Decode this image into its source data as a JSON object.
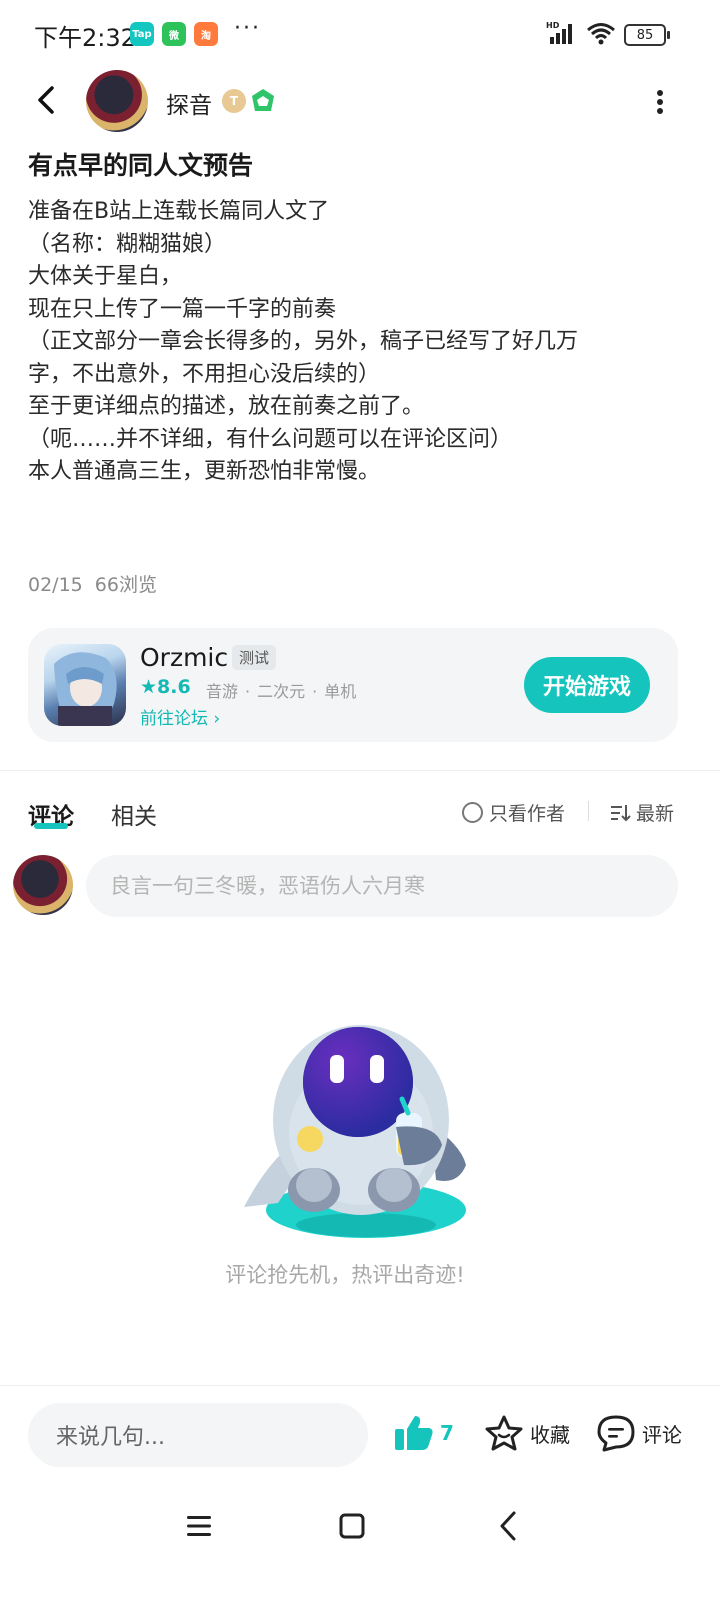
{
  "status_bar": {
    "time": "下午2:32",
    "app_badges": [
      {
        "label": "Tap",
        "color": "#14c6c0"
      },
      {
        "label": "微",
        "color": "#2dc25a"
      },
      {
        "label": "淘",
        "color": "#ff7a3c"
      }
    ],
    "dots": "···",
    "network": "HD",
    "battery": "85"
  },
  "header": {
    "username": "探音",
    "level_badge": "T"
  },
  "post": {
    "title": "有点早的同人文预告",
    "body_lines": [
      "准备在B站上连载长篇同人文了",
      "（名称：糊糊猫娘）",
      "大体关于星白，",
      "现在只上传了一篇一千字的前奏",
      "（正文部分一章会长得多的，另外，稿子已经写了好几万",
      "字，不出意外，不用担心没后续的）",
      "至于更详细点的描述，放在前奏之前了。",
      "（呃……并不详细，有什么问题可以在评论区问）",
      "本人普通高三生，更新恐怕非常慢。"
    ],
    "date": "02/15",
    "views": "66浏览"
  },
  "game_card": {
    "name": "Orzmic",
    "tag": "测试",
    "rating": "8.6",
    "genres": [
      "音游",
      "二次元",
      "单机"
    ],
    "forum_link": "前往论坛",
    "play_label": "开始游戏",
    "accent": "#15c5bd"
  },
  "tabs": {
    "comments": "评论",
    "related": "相关",
    "author_only": "只看作者",
    "sort": "最新"
  },
  "comment_input": {
    "placeholder": "良言一句三冬暖，恶语伤人六月寒"
  },
  "empty_state": {
    "text": "评论抢先机，热评出奇迹!"
  },
  "bottom_bar": {
    "say_placeholder": "来说几句...",
    "like_count": "7",
    "collect_label": "收藏",
    "comment_label": "评论"
  }
}
